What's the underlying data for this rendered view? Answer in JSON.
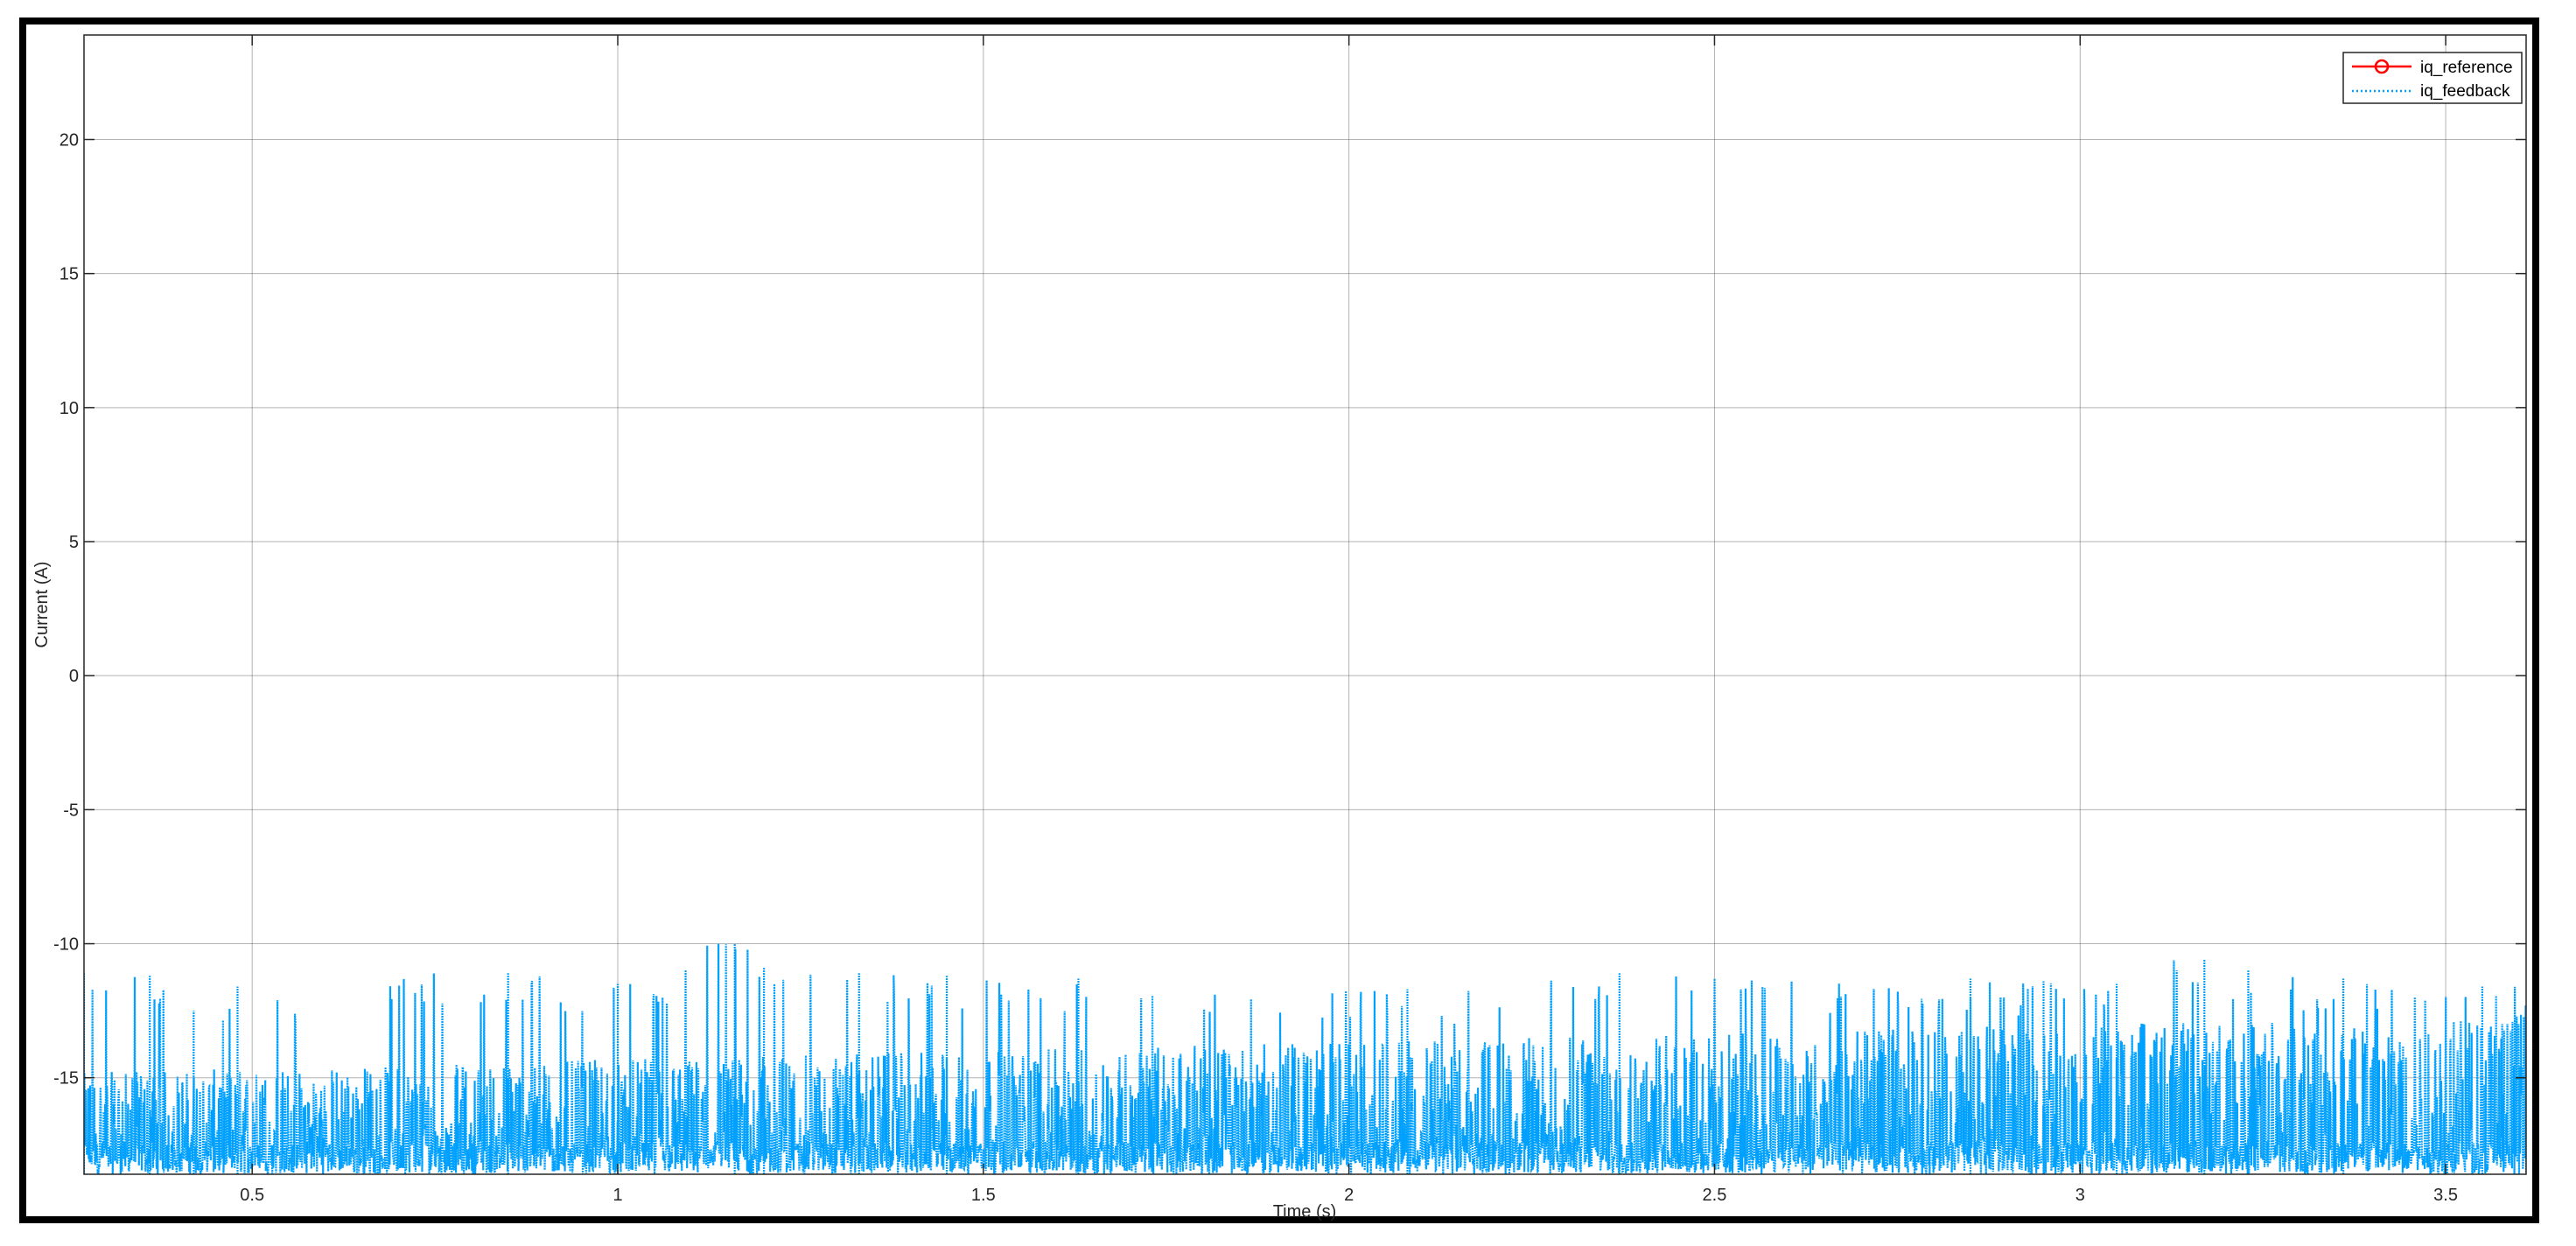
{
  "chart_data": {
    "type": "line",
    "xlabel": "Time (s)",
    "ylabel": "Current (A)",
    "xlim": [
      0.27,
      3.61
    ],
    "ylim": [
      -18.6,
      23.9
    ],
    "x_ticks": [
      0.5,
      1,
      1.5,
      2,
      2.5,
      3,
      3.5
    ],
    "x_tick_labels": [
      "0.5",
      "1",
      "1.5",
      "2",
      "2.5",
      "3",
      "3.5"
    ],
    "y_ticks": [
      -15,
      -10,
      -5,
      0,
      5,
      10,
      15,
      20
    ],
    "y_tick_labels": [
      "-15",
      "-10",
      "-5",
      "0",
      "5",
      "10",
      "15",
      "20"
    ],
    "grid": true,
    "legend_position": "top-right",
    "series": [
      {
        "name": "iq_reference",
        "color": "#ff0000",
        "style": "solid line with circle markers",
        "x": [],
        "y": []
      },
      {
        "name": "iq_feedback",
        "color": "#00a0ff",
        "style": "dotted",
        "description_range": [
          -18.6,
          -10.0
        ],
        "peak_samples": [
          {
            "x": 0.27,
            "y": -11.1
          },
          {
            "x": 0.36,
            "y": -11.2
          },
          {
            "x": 0.42,
            "y": -12.5
          },
          {
            "x": 0.48,
            "y": -11.6
          },
          {
            "x": 0.85,
            "y": -11.1
          },
          {
            "x": 1.0,
            "y": -11.5
          },
          {
            "x": 1.16,
            "y": -10.0
          },
          {
            "x": 1.2,
            "y": -10.9
          },
          {
            "x": 1.33,
            "y": -11.1
          },
          {
            "x": 1.45,
            "y": -11.2
          },
          {
            "x": 1.63,
            "y": -11.3
          },
          {
            "x": 2.08,
            "y": -11.7
          },
          {
            "x": 2.37,
            "y": -11.1
          },
          {
            "x": 2.85,
            "y": -11.3
          },
          {
            "x": 2.95,
            "y": -11.4
          },
          {
            "x": 3.05,
            "y": -11.5
          },
          {
            "x": 3.17,
            "y": -10.6
          },
          {
            "x": 3.23,
            "y": -11.0
          },
          {
            "x": 3.36,
            "y": -11.3
          },
          {
            "x": 3.55,
            "y": -11.6
          }
        ]
      }
    ]
  }
}
